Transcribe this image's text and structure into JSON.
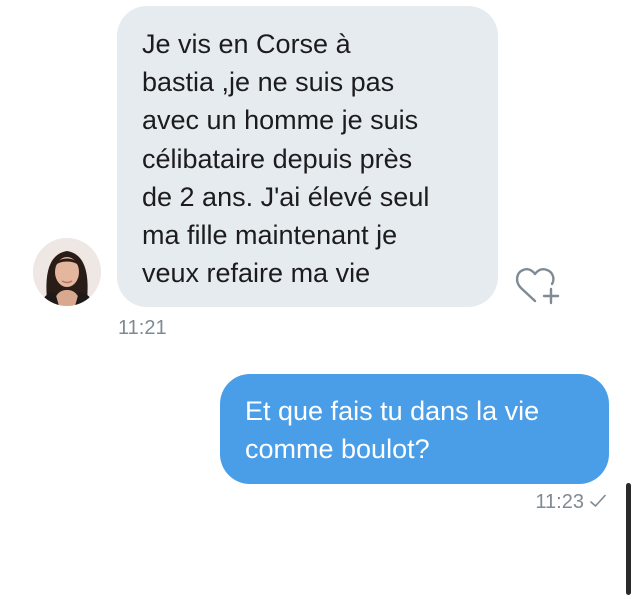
{
  "conversation": {
    "incoming": {
      "text": "Je vis en Corse à\nbastia ,je ne suis pas\navec un homme je suis\ncélibataire depuis près\nde 2 ans. J'ai élevé seul\nma fille maintenant je\nveux  refaire ma vie",
      "time": "11:21",
      "like_icon": "heart-add-icon",
      "avatar_icon": "contact-avatar"
    },
    "outgoing": {
      "text": "Et que fais tu dans la vie\ncomme boulot?",
      "time": "11:23",
      "status_icon": "check-icon"
    }
  },
  "colors": {
    "incoming_bubble": "#e6ebf0",
    "outgoing_bubble": "#4a9ee8",
    "timestamp": "#7f8a94"
  }
}
